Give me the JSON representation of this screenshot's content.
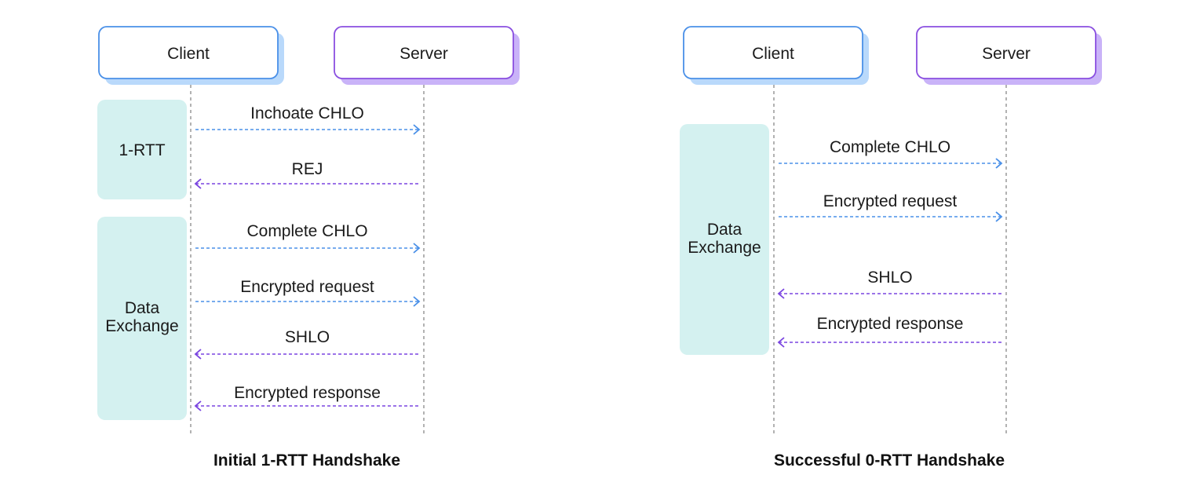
{
  "colors": {
    "client_border": "#4a90e8",
    "client_shadow": "#b9d9fb",
    "server_border": "#8a4fe0",
    "server_shadow": "#c9b3f8",
    "phase_fill": "#d4f1f0",
    "to_server_arrow": "#4a90e8",
    "to_client_arrow": "#7a45e0",
    "lifeline": "#999999"
  },
  "diagrams": [
    {
      "title": "Initial 1-RTT Handshake",
      "client_label": "Client",
      "server_label": "Server",
      "phases": [
        {
          "label": [
            "1-RTT"
          ]
        },
        {
          "label": [
            "Data",
            "Exchange"
          ]
        }
      ],
      "messages": [
        {
          "label": "Inchoate CHLO",
          "direction": "to-server"
        },
        {
          "label": "REJ",
          "direction": "to-client"
        },
        {
          "label": "Complete CHLO",
          "direction": "to-server"
        },
        {
          "label": "Encrypted request",
          "direction": "to-server"
        },
        {
          "label": "SHLO",
          "direction": "to-client"
        },
        {
          "label": "Encrypted response",
          "direction": "to-client"
        }
      ]
    },
    {
      "title": "Successful 0-RTT Handshake",
      "client_label": "Client",
      "server_label": "Server",
      "phases": [
        {
          "label": [
            "Data",
            "Exchange"
          ]
        }
      ],
      "messages": [
        {
          "label": "Complete CHLO",
          "direction": "to-server"
        },
        {
          "label": "Encrypted request",
          "direction": "to-server"
        },
        {
          "label": "SHLO",
          "direction": "to-client"
        },
        {
          "label": "Encrypted response",
          "direction": "to-client"
        }
      ]
    }
  ]
}
